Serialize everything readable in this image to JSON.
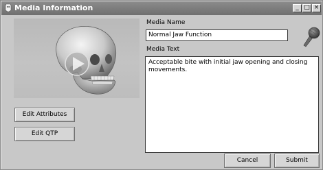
{
  "window": {
    "title": "Media Information",
    "controls": {
      "minimize": "_",
      "maximize": "□",
      "close": "×"
    }
  },
  "icons": {
    "title_icon": "media-icon",
    "preview_play": "play-icon",
    "microphone": "microphone-icon"
  },
  "preview": {
    "play_icon": "play-icon"
  },
  "buttons": {
    "edit_attributes": "Edit Attributes",
    "edit_qtp": "Edit QTP",
    "cancel": "Cancel",
    "submit": "Submit"
  },
  "fields": {
    "media_name_label": "Media Name",
    "media_name_value": "Normal Jaw Function",
    "media_text_label": "Media Text",
    "media_text_value": "Acceptable bite with initial jaw opening and closing movements."
  },
  "colors": {
    "titlebar": "#7d7d7d",
    "window_bg": "#c8c8c8",
    "field_bg": "#ffffff"
  }
}
